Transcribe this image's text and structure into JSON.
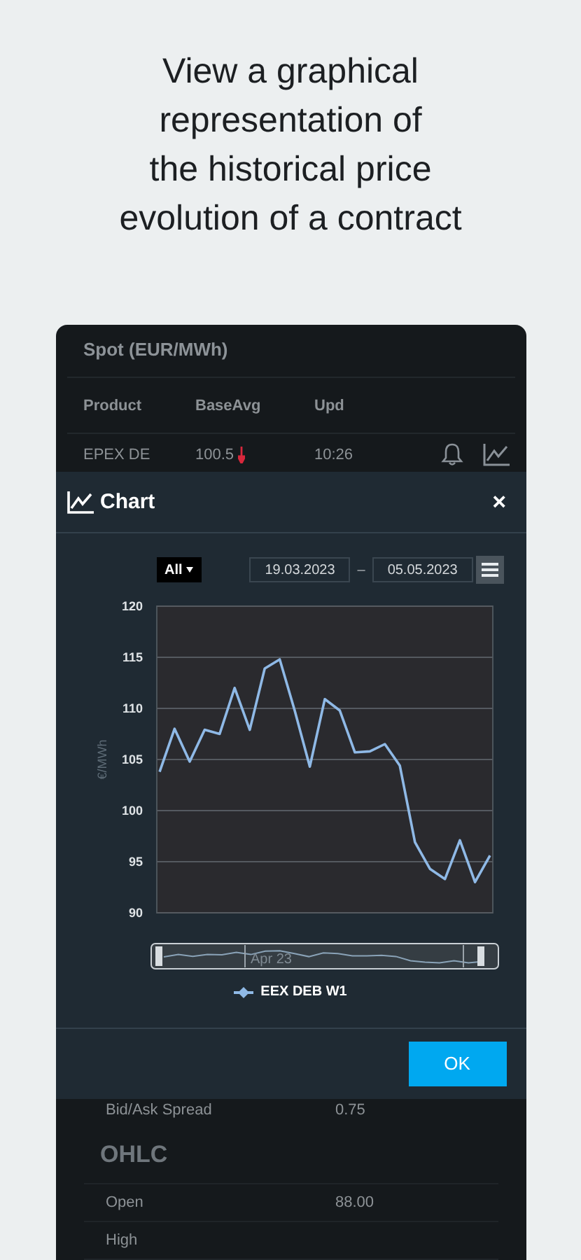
{
  "headline": "View a graphical representation of the historical price evolution of a contract",
  "background_screen": {
    "section_title": "Spot (EUR/MWh)",
    "columns": [
      "Product",
      "BaseAvg",
      "Upd"
    ],
    "rows": [
      {
        "product": "EPEX DE",
        "base_avg": "100.5",
        "price_down": true,
        "upd": "10:26"
      }
    ]
  },
  "dialog": {
    "title": "Chart",
    "close": "×",
    "range_button": "All",
    "date_from": "19.03.2023",
    "date_separator": "–",
    "date_to": "05.05.2023",
    "chart_data": {
      "type": "line",
      "ylabel": "€/MWh",
      "ylim": [
        90,
        120
      ],
      "grid": true,
      "yticks": [
        90,
        95,
        100,
        105,
        110,
        115,
        120
      ],
      "categories": [
        null,
        null,
        null,
        null,
        null,
        null,
        null,
        null,
        null,
        null,
        null,
        null,
        null,
        null,
        null,
        null,
        null,
        null,
        null,
        null,
        null,
        null,
        null
      ],
      "series": [
        {
          "name": "EEX DEB W1",
          "color": "#8fb9e6",
          "values": [
            103.8,
            108.0,
            104.8,
            107.9,
            107.5,
            112.0,
            107.9,
            113.9,
            114.8,
            109.8,
            104.3,
            110.9,
            109.8,
            105.7,
            105.8,
            106.5,
            104.4,
            96.9,
            94.3,
            93.3,
            97.1,
            93.0,
            95.6
          ]
        }
      ]
    },
    "navigator_label": "Apr 23",
    "ok_button": "OK"
  },
  "details": {
    "rows_top": [
      {
        "label": "Bid/Ask Spread",
        "value": "0.75"
      }
    ],
    "section_title": "OHLC",
    "rows": [
      {
        "label": "Open",
        "value": "88.00"
      },
      {
        "label": "High"
      }
    ]
  }
}
